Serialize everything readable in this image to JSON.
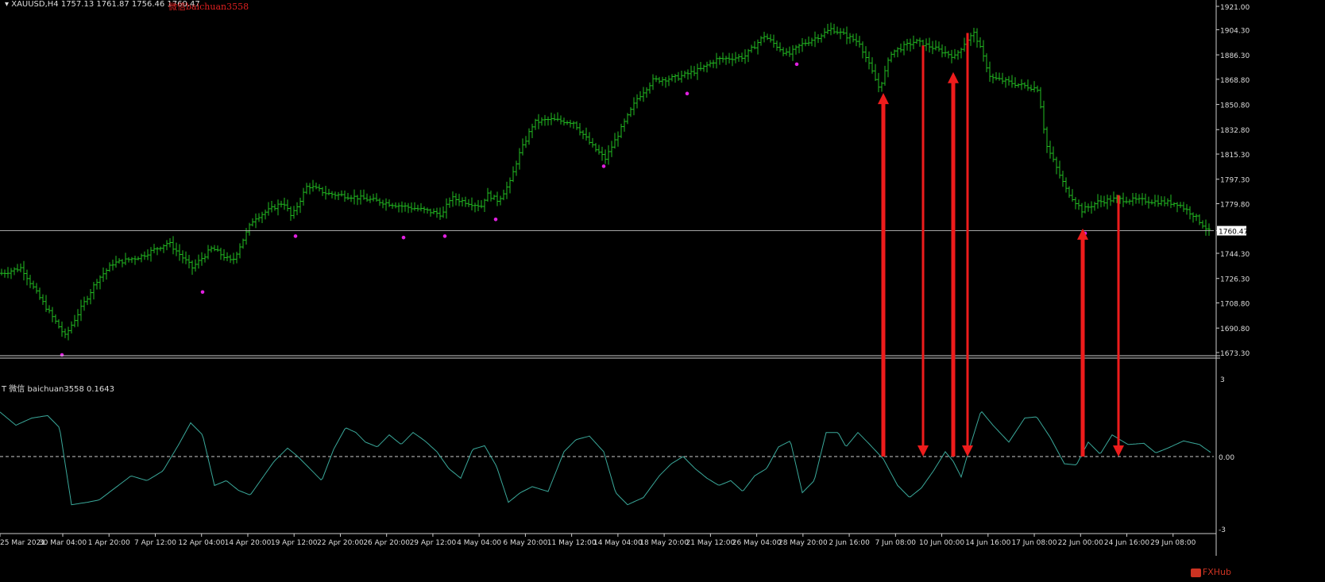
{
  "header": {
    "symbol_info": "XAUUSD,H4  1757.13 1761.87 1756.46 1760.47",
    "wechat_label": "微信baichuan3558"
  },
  "indicator": {
    "label": "T 微信 baichuan3558 0.1643",
    "y_top_label": "3",
    "y_bottom_label": "-3",
    "zero_label": "0.00"
  },
  "watermark": "FXHub",
  "colors": {
    "background": "#000000",
    "bars": "#22bb22",
    "fractal_dots": "#e020e0",
    "indicator_line": "#3aa89a",
    "arrows": "#ee1c1c",
    "grid_text": "#dddddd"
  },
  "chart_data": [
    {
      "type": "line",
      "subtype": "ohlc-bars",
      "title": "",
      "ylim": [
        1673.3,
        1921.0
      ],
      "y_ticks": [
        "1921.00",
        "1904.30",
        "1886.30",
        "1868.80",
        "1850.80",
        "1832.80",
        "1815.30",
        "1797.30",
        "1779.80",
        "1760.47",
        "1744.30",
        "1726.30",
        "1708.80",
        "1690.80",
        "1673.30"
      ],
      "current_price": 1760.47,
      "x_ticks": [
        "25 Mar 2021",
        "30 Mar 04:00",
        "1 Apr 20:00",
        "7 Apr 12:00",
        "12 Apr 04:00",
        "14 Apr 20:00",
        "19 Apr 12:00",
        "22 Apr 20:00",
        "26 Apr 20:00",
        "29 Apr 12:00",
        "4 May 04:00",
        "6 May 20:00",
        "11 May 12:00",
        "14 May 04:00",
        "18 May 20:00",
        "21 May 12:00",
        "26 May 04:00",
        "28 May 20:00",
        "2 Jun 16:00",
        "7 Jun 08:00",
        "10 Jun 00:00",
        "14 Jun 16:00",
        "17 Jun 08:00",
        "22 Jun 00:00",
        "24 Jun 16:00",
        "29 Jun 08:00"
      ],
      "series": [
        {
          "kind": "close_path",
          "x_index": [
            0,
            25,
            45,
            80,
            120,
            140,
            175,
            210,
            240,
            265,
            290,
            315,
            320,
            355,
            365,
            385,
            410,
            440,
            470,
            505,
            525,
            555,
            565,
            605,
            610,
            625,
            640,
            650,
            670,
            690,
            720,
            745,
            760,
            800,
            820,
            850,
            880,
            900,
            935,
            960,
            990,
            1005,
            1030,
            1045,
            1080,
            1105,
            1120,
            1150,
            1170,
            1200,
            1215,
            1225,
            1245,
            1280,
            1305,
            1315,
            1340,
            1360,
            1380,
            1400,
            1440,
            1480,
            1500,
            1520
          ],
          "close": [
            1730,
            1734,
            1715,
            1685,
            1725,
            1737,
            1742,
            1752,
            1734,
            1748,
            1738,
            1767,
            1770,
            1781,
            1770,
            1793,
            1787,
            1785,
            1782,
            1778,
            1776,
            1772,
            1784,
            1778,
            1787,
            1782,
            1795,
            1813,
            1838,
            1840,
            1838,
            1820,
            1812,
            1855,
            1868,
            1870,
            1876,
            1883,
            1885,
            1900,
            1886,
            1893,
            1900,
            1905,
            1895,
            1862,
            1888,
            1896,
            1892,
            1885,
            1897,
            1902,
            1870,
            1865,
            1862,
            1822,
            1790,
            1775,
            1781,
            1783,
            1782,
            1780,
            1772,
            1760
          ]
        },
        {
          "kind": "fractal_lows",
          "x_index": [
            78,
            255,
            372,
            508,
            560,
            624,
            760,
            865,
            1003,
            1112,
            1200,
            1366
          ],
          "price": [
            1675,
            1720,
            1760,
            1759,
            1760,
            1772,
            1810,
            1862,
            1883,
            1859,
            1874,
            1762
          ]
        }
      ]
    },
    {
      "type": "line",
      "title": "T 微信 baichuan3558 0.1643",
      "ylim": [
        -3,
        3
      ],
      "zero_line": 0.0,
      "series": [
        {
          "name": "",
          "x_index": [
            0,
            20,
            40,
            60,
            75,
            90,
            110,
            125,
            145,
            165,
            185,
            205,
            225,
            240,
            255,
            270,
            285,
            300,
            315,
            330,
            345,
            362,
            375,
            390,
            405,
            420,
            435,
            448,
            460,
            475,
            490,
            505,
            520,
            535,
            550,
            565,
            580,
            595,
            610,
            625,
            640,
            655,
            670,
            690,
            710,
            725,
            742,
            760,
            775,
            790,
            810,
            830,
            845,
            860,
            875,
            890,
            905,
            920,
            935,
            950,
            965,
            980,
            995,
            1010,
            1025,
            1040,
            1055,
            1065,
            1080,
            1092,
            1112,
            1130,
            1145,
            1160,
            1175,
            1190,
            1200,
            1210,
            1220,
            1235,
            1250,
            1270,
            1290,
            1305,
            1322,
            1340,
            1355,
            1370,
            1385,
            1400,
            1420,
            1440,
            1455,
            1470,
            1490,
            1510,
            1525
          ],
          "y": [
            1.85,
            1.3,
            1.6,
            1.7,
            1.2,
            -2.0,
            -1.9,
            -1.8,
            -1.3,
            -0.8,
            -1.0,
            -0.6,
            0.5,
            1.4,
            0.9,
            -1.2,
            -1.0,
            -1.4,
            -1.6,
            -0.9,
            -0.2,
            0.35,
            0.0,
            -0.5,
            -1.0,
            0.3,
            1.2,
            1.0,
            0.6,
            0.4,
            0.9,
            0.5,
            1.0,
            0.65,
            0.2,
            -0.5,
            -0.9,
            0.3,
            0.45,
            -0.4,
            -1.9,
            -1.5,
            -1.25,
            -1.45,
            0.2,
            0.7,
            0.85,
            0.2,
            -1.5,
            -2.0,
            -1.7,
            -0.8,
            -0.3,
            0.0,
            -0.5,
            -0.9,
            -1.2,
            -1.0,
            -1.45,
            -0.8,
            -0.5,
            0.4,
            0.65,
            -1.5,
            -1.0,
            1.0,
            1.0,
            0.4,
            1.0,
            0.6,
            -0.1,
            -1.2,
            -1.7,
            -1.3,
            -0.6,
            0.2,
            -0.2,
            -0.85,
            0.3,
            1.9,
            1.3,
            0.6,
            1.6,
            1.65,
            0.8,
            -0.3,
            -0.35,
            0.6,
            0.1,
            0.9,
            0.5,
            0.55,
            0.15,
            0.35,
            0.65,
            0.5,
            0.15
          ]
        }
      ],
      "arrows": [
        {
          "x_index": 1112,
          "direction": "up",
          "from": "indicator_zero",
          "to_price": 1859
        },
        {
          "x_index": 1162,
          "direction": "down",
          "from_price": 1893,
          "to": "indicator_zero"
        },
        {
          "x_index": 1200,
          "direction": "up",
          "from": "indicator_zero",
          "to_price": 1874
        },
        {
          "x_index": 1218,
          "direction": "down",
          "from_price": 1902,
          "to": "indicator_zero"
        },
        {
          "x_index": 1363,
          "direction": "up",
          "from": "indicator_zero",
          "to_price": 1762
        },
        {
          "x_index": 1408,
          "direction": "down",
          "from_price": 1786,
          "to": "indicator_zero"
        }
      ]
    }
  ]
}
